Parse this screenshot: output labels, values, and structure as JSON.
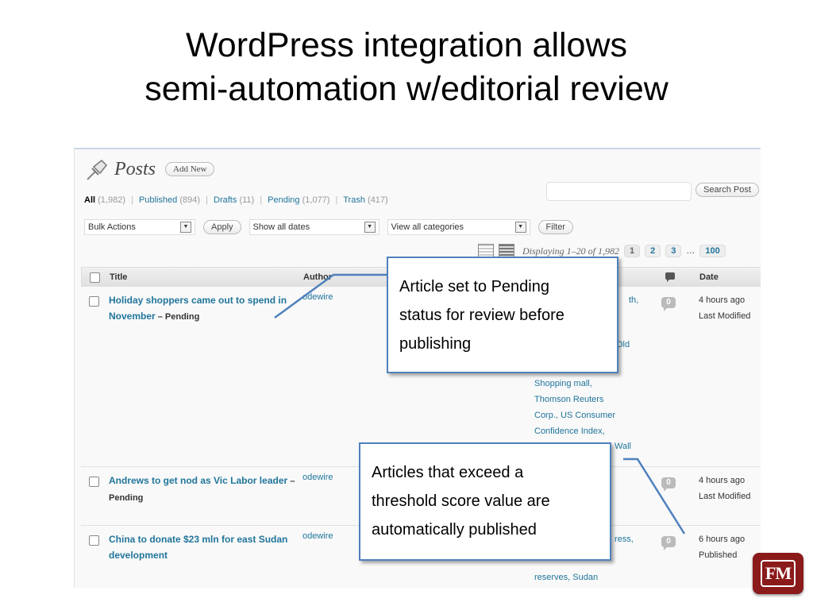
{
  "slide": {
    "title_line1": "WordPress integration allows",
    "title_line2": "semi-automation w/editorial review"
  },
  "wp": {
    "heading": "Posts",
    "add_new": "Add New",
    "filters": {
      "all": "All",
      "all_count": "(1,982)",
      "published": "Published",
      "published_count": "(894)",
      "drafts": "Drafts",
      "drafts_count": "(11)",
      "pending": "Pending",
      "pending_count": "(1,077)",
      "trash": "Trash",
      "trash_count": "(417)",
      "separator": "|"
    },
    "search_button": "Search Post",
    "bulk_actions": "Bulk Actions",
    "apply": "Apply",
    "dates": "Show all dates",
    "categories": "View all categories",
    "filter": "Filter",
    "displaying": "Displaying 1–20 of 1,982",
    "pages": [
      "1",
      "2",
      "3",
      "…",
      "100"
    ],
    "columns": {
      "title": "Title",
      "author": "Author",
      "date": "Date"
    },
    "rows": [
      {
        "title": "Holiday shoppers came out to spend in November",
        "state": " – Pending",
        "author": "odewire",
        "comments": "0",
        "date_line1": "4 hours ago",
        "date_line2": "Last Modified",
        "tags_top1": "th,",
        "tags_top2": "Old",
        "tags": [
          "Shopping mall,",
          "Thomson Reuters",
          "Corp., US Consumer",
          "Confidence Index,"
        ],
        "tags_tail": "Wall"
      },
      {
        "title": "Andrews to get nod as Vic Labor leader",
        "state": " – Pending",
        "author": "odewire",
        "comments": "0",
        "date_line1": "4 hours ago",
        "date_line2": "Last Modified"
      },
      {
        "title": "China to donate $23 mln for east Sudan development",
        "state": "",
        "author": "odewire",
        "comments": "0",
        "date_line1": "6 hours ago",
        "date_line2": "Published",
        "tags_top": "ress,",
        "tags_bottom": "reserves, Sudan"
      }
    ]
  },
  "callouts": {
    "pending": [
      "Article set to Pending",
      "status for review  before",
      "publishing"
    ],
    "published": [
      "Articles that exceed a",
      "threshold score value are",
      "automatically published"
    ]
  },
  "logo": {
    "text": "FM"
  },
  "colors": {
    "link": "#21759b",
    "callout_border": "#4f81bd",
    "logo": "#8b1a1a"
  }
}
